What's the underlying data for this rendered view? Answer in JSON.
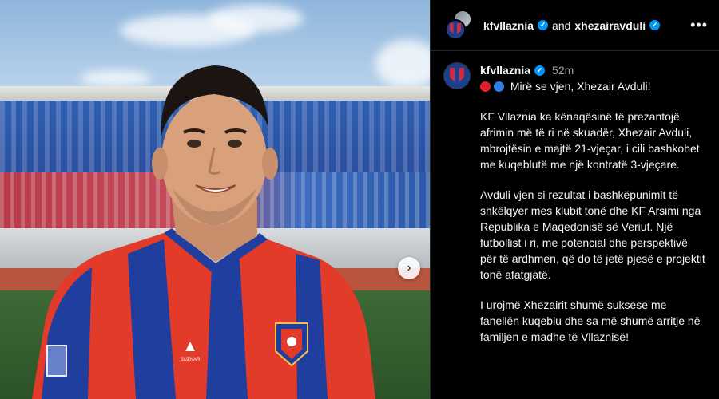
{
  "post": {
    "next_icon": "chevron-right-icon",
    "colors": {
      "jersey_red": "#e23b2a",
      "jersey_blue": "#1f3e9e",
      "accent_blue": "#0095f6"
    }
  },
  "header": {
    "user1": "kfvllaznia",
    "joiner": "and",
    "user2": "xhezairavduli",
    "more_icon": "more-horizontal-icon",
    "more_label": "•••"
  },
  "caption": {
    "username": "kfvllaznia",
    "time": "52m",
    "greeting": "Mirë se vjen, Xhezair Avduli!",
    "paragraphs": [
      "KF Vllaznia ka kënaqësinë të prezantojë afrimin më të ri në skuadër, Xhezair Avduli, mbrojtësin e majtë 21-vjeçar, i cili bashkohet me kuqeblutë me një kontratë 3-vjeçare.",
      "Avduli vjen si rezultat i bashkëpunimit të shkëlqyer mes klubit tonë dhe KF Arsimi nga Republika e Maqedonisë së Veriut. Një futbollist i ri, me potencial dhe perspektivë për të ardhmen, që do të jetë pjesë e projektit tonë afatgjatë.",
      "I urojmë Xhezairit shumë suksese me fanellën kuqeblu dhe sa më shumë arritje në familjen e madhe të Vllaznisë!"
    ]
  }
}
